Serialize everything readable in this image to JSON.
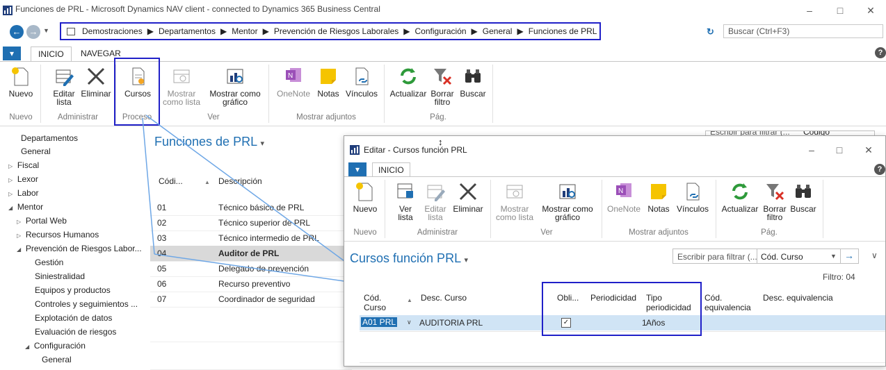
{
  "window": {
    "title": "Funciones de PRL - Microsoft Dynamics NAV client - connected to Dynamics 365 Business Central",
    "min": "–",
    "max": "□",
    "close": "✕"
  },
  "address": {
    "crumbs": [
      "Demostraciones",
      "Departamentos",
      "Mentor",
      "Prevención de Riesgos Laborales",
      "Configuración",
      "General",
      "Funciones de PRL"
    ],
    "search_placeholder": "Buscar (Ctrl+F3)"
  },
  "tabs": {
    "menu": "▾",
    "inicio": "INICIO",
    "navegar": "NAVEGAR"
  },
  "ribbon": {
    "nuevo": "Nuevo",
    "editar_lista_1": "Editar",
    "editar_lista_2": "lista",
    "eliminar": "Eliminar",
    "cursos": "Cursos",
    "mostrar_lista_1": "Mostrar",
    "mostrar_lista_2": "como lista",
    "mostrar_grafico_1": "Mostrar como",
    "mostrar_grafico_2": "gráfico",
    "onenote": "OneNote",
    "notas": "Notas",
    "vinculos": "Vínculos",
    "actualizar": "Actualizar",
    "borrar_filtro_1": "Borrar",
    "borrar_filtro_2": "filtro",
    "buscar": "Buscar",
    "groups": {
      "nuevo": "Nuevo",
      "administrar": "Administrar",
      "proceso": "Proceso",
      "ver": "Ver",
      "adjuntos": "Mostrar adjuntos",
      "pag": "Pág."
    }
  },
  "nav": {
    "items": [
      {
        "label": "Departamentos"
      },
      {
        "label": "General"
      },
      {
        "label": "Fiscal"
      },
      {
        "label": "Lexor"
      },
      {
        "label": "Labor"
      },
      {
        "label": "Mentor"
      },
      {
        "label": "Portal Web"
      },
      {
        "label": "Recursos Humanos"
      },
      {
        "label": "Prevención de Riesgos Labor..."
      },
      {
        "label": "Gestión"
      },
      {
        "label": "Siniestralidad"
      },
      {
        "label": "Equipos y productos"
      },
      {
        "label": "Controles y seguimientos ..."
      },
      {
        "label": "Explotación de datos"
      },
      {
        "label": "Evaluación de riesgos"
      },
      {
        "label": "Configuración"
      },
      {
        "label": "General"
      }
    ]
  },
  "list": {
    "title": "Funciones de PRL",
    "col_code": "Códi...",
    "col_desc": "Descripción",
    "rows": [
      {
        "code": "01",
        "desc": "Técnico básico de PRL"
      },
      {
        "code": "02",
        "desc": "Técnico superior de PRL"
      },
      {
        "code": "03",
        "desc": "Técnico intermedio de PRL"
      },
      {
        "code": "04",
        "desc": "Auditor de PRL"
      },
      {
        "code": "05",
        "desc": "Delegado de prevención"
      },
      {
        "code": "06",
        "desc": "Recurso preventivo"
      },
      {
        "code": "07",
        "desc": "Coordinador de seguridad"
      }
    ],
    "filter_placeholder": "Escribir para filtrar (...",
    "filter_field": "Código"
  },
  "dialog": {
    "title": "Editar - Cursos función PRL",
    "tab": "INICIO",
    "nuevo": "Nuevo",
    "ver_lista_1": "Ver",
    "ver_lista_2": "lista",
    "editar_lista_1": "Editar",
    "editar_lista_2": "lista",
    "eliminar": "Eliminar",
    "mostrar_lista_1": "Mostrar",
    "mostrar_lista_2": "como lista",
    "mostrar_grafico_1": "Mostrar como",
    "mostrar_grafico_2": "gráfico",
    "onenote": "OneNote",
    "notas": "Notas",
    "vinculos": "Vínculos",
    "actualizar": "Actualizar",
    "borrar_filtro_1": "Borrar",
    "borrar_filtro_2": "filtro",
    "buscar": "Buscar",
    "groups": {
      "nuevo": "Nuevo",
      "administrar": "Administrar",
      "ver": "Ver",
      "adjuntos": "Mostrar adjuntos",
      "pag": "Pág."
    },
    "page_title": "Cursos función PRL",
    "filter_placeholder": "Escribir para filtrar (...",
    "filter_field": "Cód. Curso",
    "filter_status": "Filtro: 04",
    "cols": {
      "cod_curso_1": "Cód.",
      "cod_curso_2": "Curso",
      "desc_curso": "Desc. Curso",
      "obli": "Obli...",
      "periodicidad": "Periodicidad",
      "tipo_1": "Tipo",
      "tipo_2": "periodicidad",
      "cod_eq_1": "Cód.",
      "cod_eq_2": "equivalencia",
      "desc_eq": "Desc. equivalencia"
    },
    "row": {
      "code": "A01 PRL",
      "desc": "AUDITORIA PRL",
      "obligatorio": true,
      "periodicidad": "1",
      "tipo": "Años"
    }
  },
  "colors": {
    "accent": "#1f6fb2",
    "highlight": "#2020c8",
    "ribbon_tab": "#1f6fb2",
    "selected_row": "#d0e4f5"
  }
}
